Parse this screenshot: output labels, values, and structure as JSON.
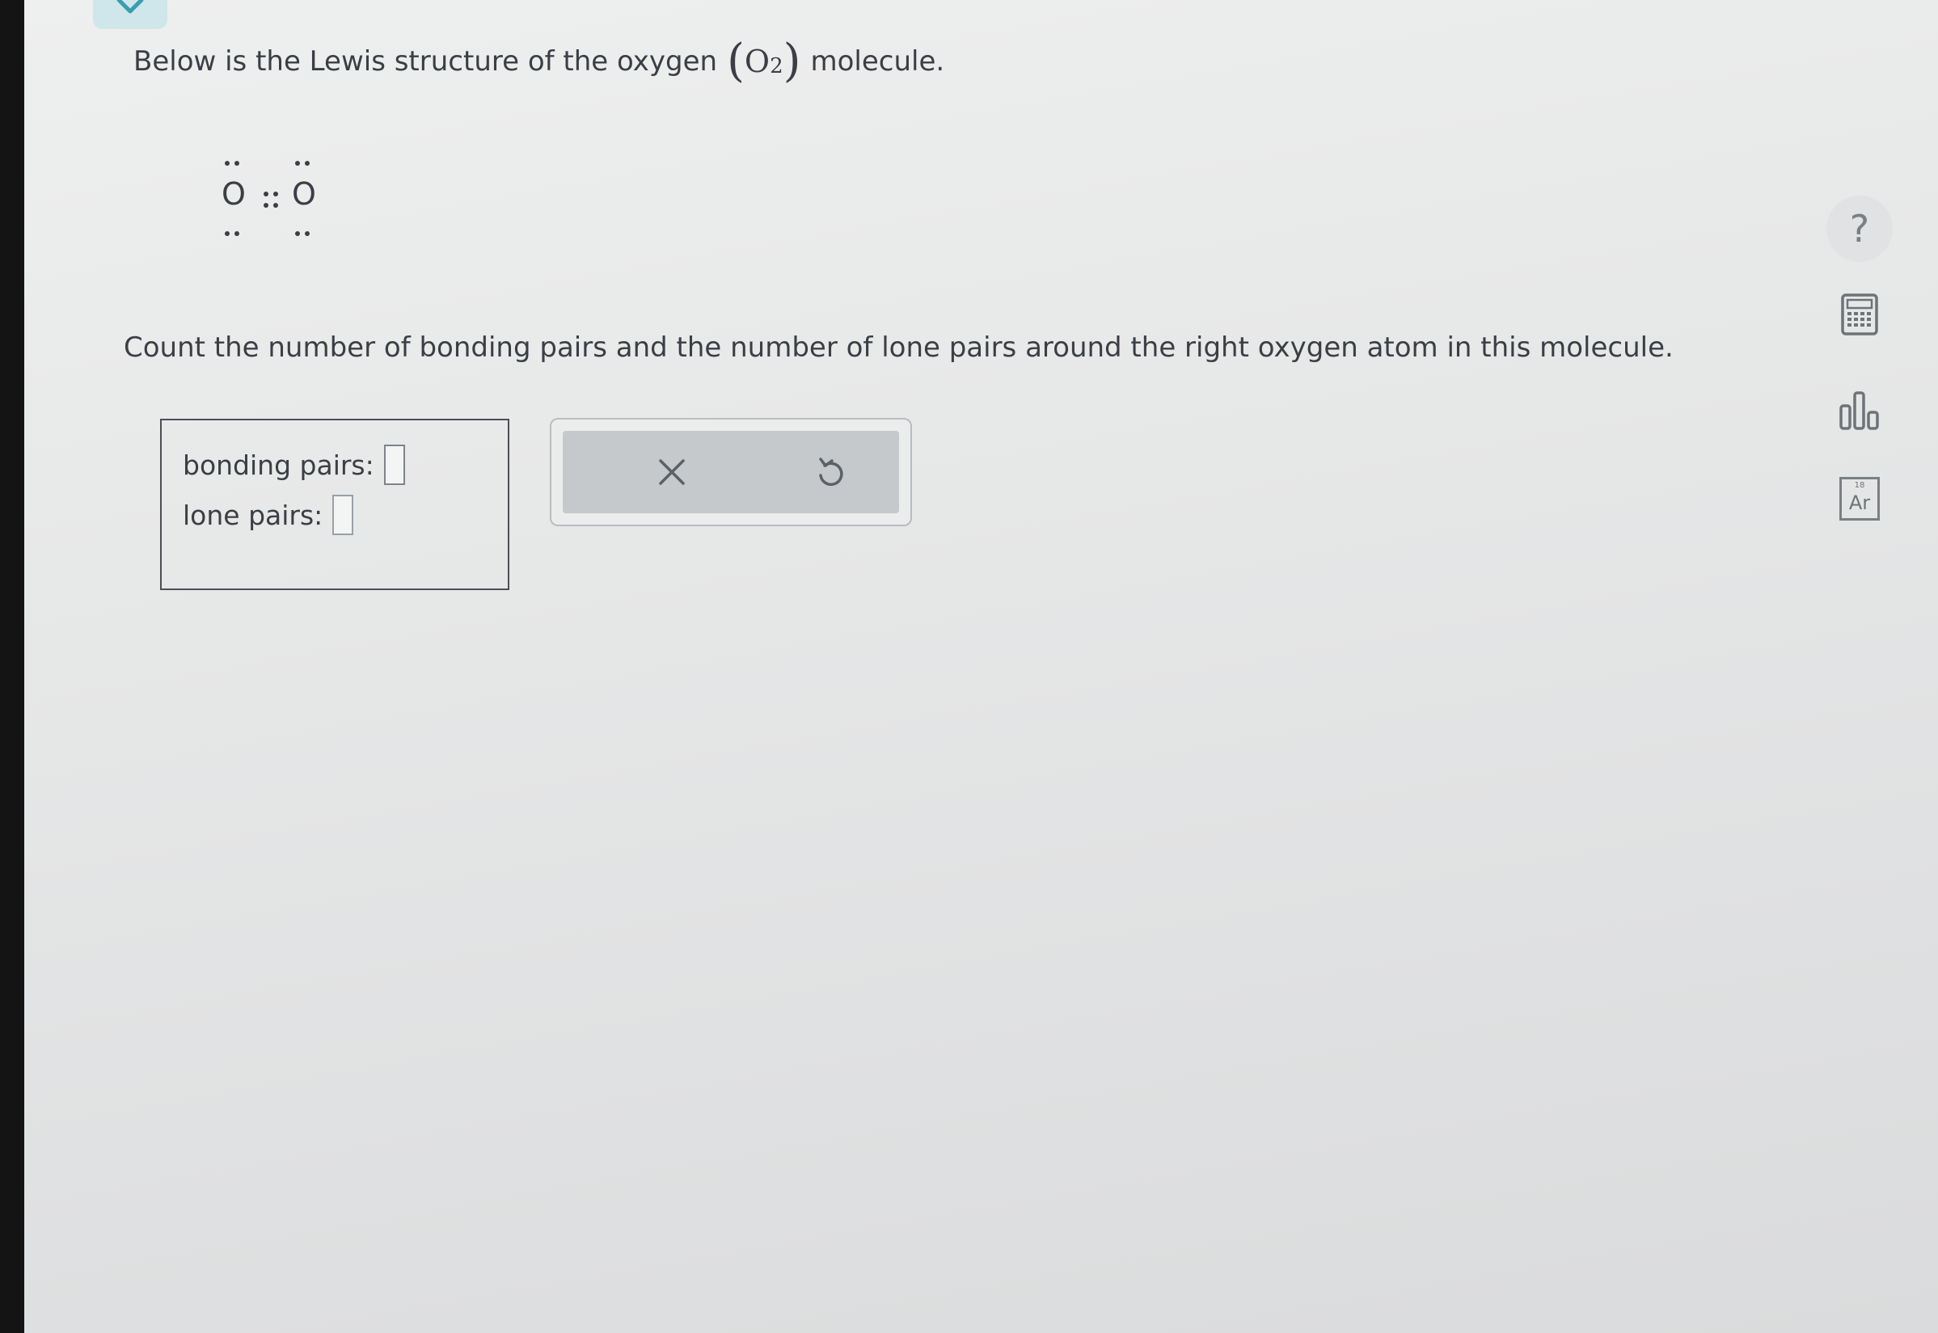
{
  "intro": {
    "text_before": "Below is the Lewis structure of the oxygen",
    "formula_element": "O",
    "formula_subscript": "2",
    "text_after": "molecule."
  },
  "lewis": {
    "left_atom": "O",
    "right_atom": "O",
    "bond_symbol": "::"
  },
  "question": {
    "text": "Count the number of bonding pairs and the number of lone pairs around the right oxygen atom in this molecule."
  },
  "answer": {
    "bonding_label": "bonding pairs:",
    "bonding_value": "",
    "lone_label": "lone pairs:",
    "lone_value": ""
  },
  "buttons": {
    "clear_icon": "x-icon",
    "undo_icon": "undo-icon"
  },
  "tools": {
    "help_label": "?",
    "calculator_icon": "calculator-icon",
    "data_icon": "bar-chart-icon",
    "periodic_label": "Ar",
    "periodic_number": "18"
  }
}
